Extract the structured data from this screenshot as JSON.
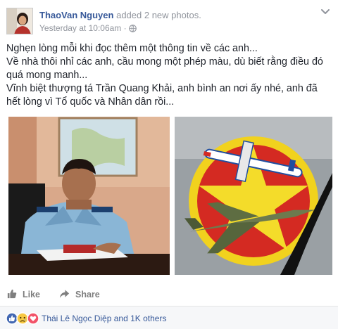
{
  "post": {
    "author": "ThaoVan Nguyen",
    "action_text": "added 2 new photos.",
    "timestamp": "Yesterday at 10:06am",
    "privacy_separator": "·",
    "privacy_icon": "globe-icon",
    "menu_icon": "chevron-down-icon",
    "text_lines": [
      "Nghẹn lòng mỗi khi đọc thêm một thông tin về các anh...",
      "Về nhà thôi nhỉ các anh, cầu mong một phép màu, dù biết rằng điều đó quá mong manh...",
      "Vĩnh biệt thượng tá Trần Quang Khải, anh bình an nơi ấy nhé, anh đã hết lòng vì Tổ quốc và Nhân dân rồi..."
    ],
    "photo_count": 2
  },
  "actions": {
    "like_label": "Like",
    "like_icon": "thumbs-up-icon",
    "share_label": "Share",
    "share_icon": "share-arrow-icon"
  },
  "reactions": {
    "icons": [
      "like-reaction-icon",
      "sad-reaction-icon",
      "love-reaction-icon"
    ],
    "summary": "Thái Lê Ngọc Diệp and 1K others"
  },
  "colors": {
    "link_blue": "#365899",
    "text": "#1d2129",
    "meta_gray": "#90949c",
    "footer_bg": "#f6f7f9"
  }
}
